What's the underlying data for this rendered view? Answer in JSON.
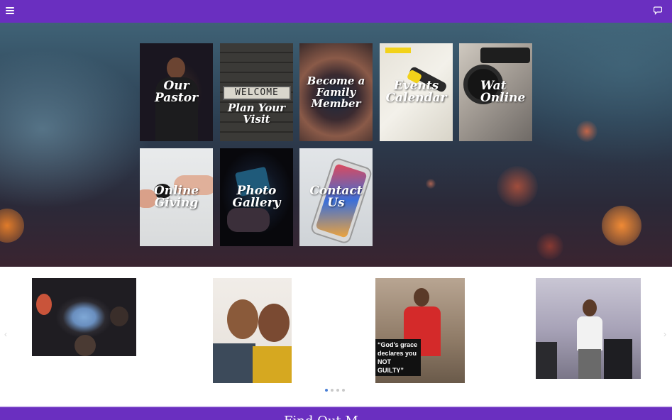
{
  "topbar": {
    "menu_icon": "hamburger-menu-icon",
    "chat_icon": "chat-bubble-icon",
    "color": "#6a2fc0"
  },
  "tiles": [
    {
      "label": "Our\nPastor",
      "image": "preacher-on-stage"
    },
    {
      "label": "Plan Your\nVisit",
      "sign_text": "WELCOME",
      "image": "welcome-sign"
    },
    {
      "label": "Become a\nFamily\nMember",
      "image": "hands-circle"
    },
    {
      "label": "Events\nCalendar",
      "image": "calendar-notepad"
    },
    {
      "label": "Wat\nOnline",
      "image": "video-camera"
    },
    {
      "label": "Online\nGiving",
      "image": "hand-giving-heart"
    },
    {
      "label": "Photo\nGallery",
      "image": "camera-in-hand"
    },
    {
      "label": "Contact\nUs",
      "image": "smartphone"
    }
  ],
  "carousel": {
    "slides": [
      {
        "image": "group-huddle-from-below"
      },
      {
        "image": "two-women-selfie"
      },
      {
        "image": "man-speaking-red-shirt",
        "caption": "“God's grace\ndeclares you\nNOT GUILTY”"
      },
      {
        "image": "woman-speaking-at-podium"
      }
    ],
    "prev_icon": "chevron-left-icon",
    "next_icon": "chevron-right-icon",
    "dot_count": 4,
    "active_dot": 0
  },
  "footer": {
    "text": "Find Out M",
    "color": "#6a2fc0"
  }
}
